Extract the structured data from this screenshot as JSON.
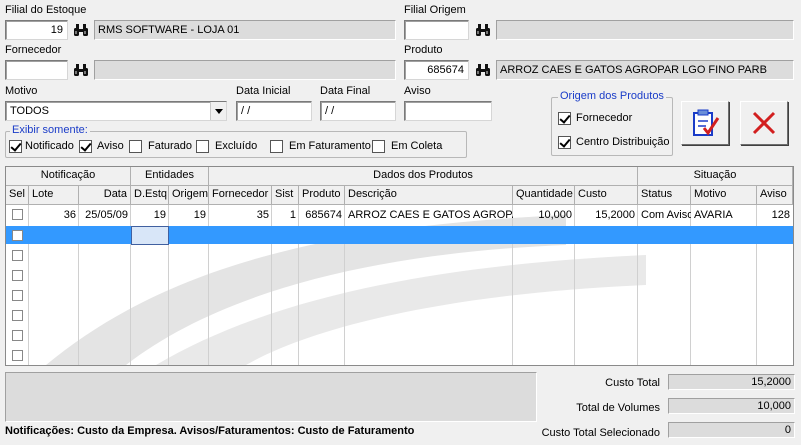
{
  "filters": {
    "filial_estoque_label": "Filial do Estoque",
    "filial_estoque_code": "19",
    "filial_estoque_name": "RMS SOFTWARE - LOJA 01",
    "filial_origem_label": "Filial Origem",
    "filial_origem_code": "",
    "filial_origem_name": "",
    "fornecedor_label": "Fornecedor",
    "fornecedor_code": "",
    "fornecedor_name": "",
    "produto_label": "Produto",
    "produto_code": "685674",
    "produto_name": "ARROZ CAES E GATOS AGROPAR LGO FINO PARB",
    "motivo_label": "Motivo",
    "motivo_value": "TODOS",
    "data_inicial_label": "Data Inicial",
    "data_inicial_value": " / /",
    "data_final_label": "Data Final",
    "data_final_value": " / /",
    "aviso_label": "Aviso",
    "aviso_value": ""
  },
  "exibir": {
    "title": "Exibir somente:",
    "items": [
      {
        "label": "Notificado",
        "checked": true
      },
      {
        "label": "Aviso",
        "checked": true
      },
      {
        "label": "Faturado",
        "checked": false
      },
      {
        "label": "Excluído",
        "checked": false
      },
      {
        "label": "Em Faturamento",
        "checked": false
      },
      {
        "label": "Em Coleta",
        "checked": false
      }
    ]
  },
  "origem": {
    "title": "Origem dos  Produtos",
    "items": [
      {
        "label": "Fornecedor",
        "checked": true
      },
      {
        "label": "Centro Distribuição",
        "checked": true
      }
    ]
  },
  "grid": {
    "groups": [
      "Notificação",
      "Entidades",
      "Dados dos Produtos",
      "Situação"
    ],
    "columns": [
      "Sel",
      "Lote",
      "Data",
      "D.Estq",
      "Origem",
      "Fornecedor",
      "Sist",
      "Produto",
      "Descrição",
      "Quantidade",
      "Custo",
      "Status",
      "Motivo",
      "Aviso"
    ],
    "rows": [
      {
        "sel": false,
        "lote": "36",
        "data": "25/05/09",
        "destq": "19",
        "origem": "19",
        "fornecedor": "35",
        "sist": "1",
        "produto": "685674",
        "descricao": "ARROZ CAES E GATOS AGROPA",
        "quantidade": "10,000",
        "custo": "15,2000",
        "status": "Com Aviso",
        "motivo": "AVARIA",
        "aviso": "128"
      }
    ],
    "empty_rows": 8
  },
  "totals": {
    "custo_total_label": "Custo Total",
    "custo_total_value": "15,2000",
    "total_volumes_label": "Total de Volumes",
    "total_volumes_value": "10,000",
    "custo_selecionado_label": "Custo Total Selecionado",
    "custo_selecionado_value": "0"
  },
  "footer": {
    "note": "Notificações: Custo da Empresa. Avisos/Faturamentos: Custo de Faturamento"
  },
  "icons": {
    "search": "binoculars-icon",
    "confirm": "checklist-icon",
    "close": "close-icon"
  },
  "colors": {
    "selection": "#3399ff",
    "group_title": "#1a3cc8",
    "close_red": "#d21f1f"
  }
}
